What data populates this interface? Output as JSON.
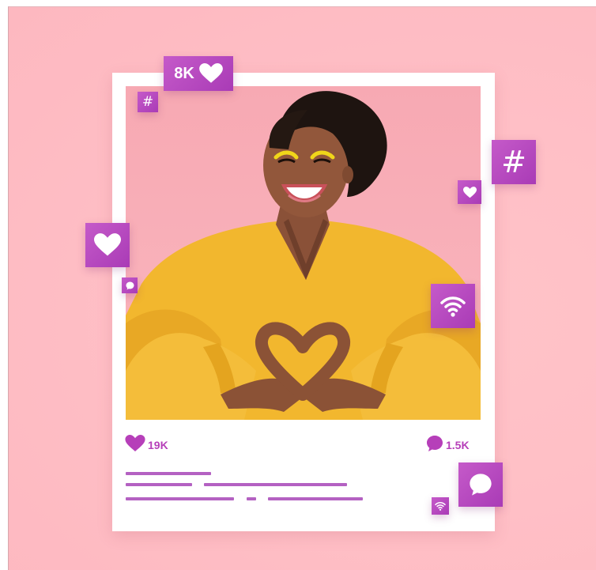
{
  "post": {
    "likes_count": "19K",
    "comments_count": "1.5K",
    "caption_lines": 3
  },
  "badges": {
    "likes_badge": "8K",
    "hashtag_symbol": "#"
  },
  "icons": [
    "heart-icon",
    "hashtag-icon",
    "speech-bubble-icon",
    "wifi-icon"
  ],
  "colors": {
    "background": "#ffbfc6",
    "accent": "#b63fb9",
    "card": "#ffffff",
    "shirt": "#f2b72e"
  }
}
